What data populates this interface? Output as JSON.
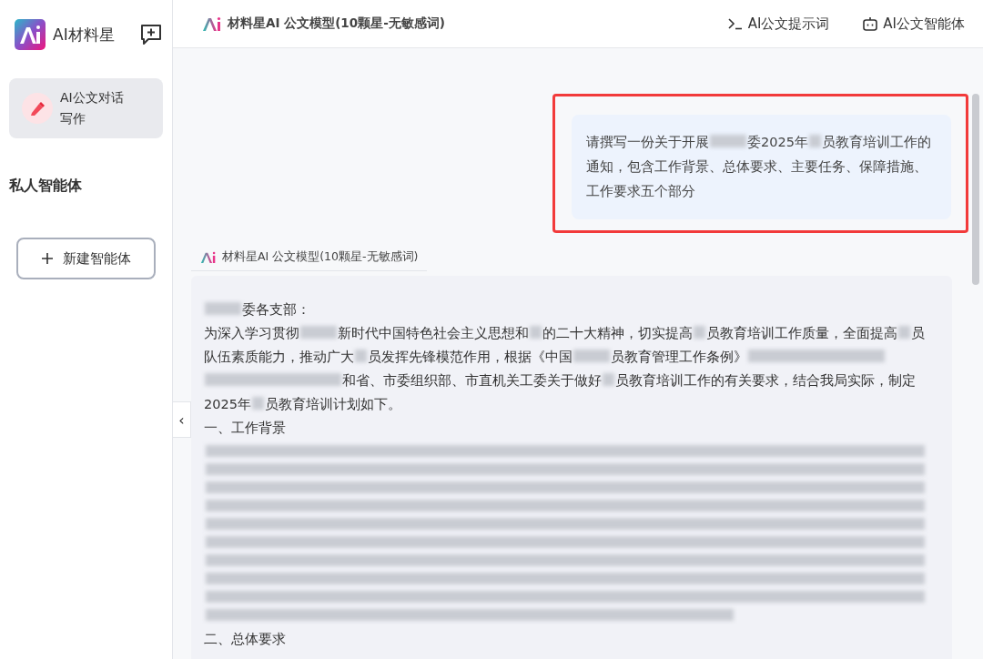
{
  "sidebar": {
    "app_name": "AI材料星",
    "nav_items": [
      {
        "label": "AI公文对话写作",
        "selected": true
      }
    ],
    "section_title": "私人智能体",
    "new_agent_button": "新建智能体",
    "collapse_toggle": "‹"
  },
  "header": {
    "model_name": "材料星AI 公文模型(10颗星-无敏感词)",
    "links": [
      {
        "kind": "prompt",
        "label": "AI公文提示词"
      },
      {
        "kind": "agent",
        "label": "AI公文智能体"
      }
    ]
  },
  "chat": {
    "user_message": {
      "highlighted": true,
      "segments": [
        {
          "kind": "text",
          "text": "请撰写一份关于开展"
        },
        {
          "kind": "word"
        },
        {
          "kind": "text",
          "text": "委2025年"
        },
        {
          "kind": "dot"
        },
        {
          "kind": "text",
          "text": "员教育培训工作的通知，包含工作背景、总体要求、主要任务、保障措施、工作要求五个部分"
        }
      ]
    },
    "reply": {
      "model_name": "材料星AI 公文模型(10颗星-无敏感词)",
      "paragraphs": [
        {
          "segments": [
            {
              "kind": "word"
            },
            {
              "kind": "text",
              "text": "委各支部："
            }
          ]
        },
        {
          "segments": [
            {
              "kind": "text",
              "text": "为深入学习贯彻"
            },
            {
              "kind": "word"
            },
            {
              "kind": "text",
              "text": "新时代中国特色社会主义思想和"
            },
            {
              "kind": "dot"
            },
            {
              "kind": "text",
              "text": "的二十大精神，切实提高"
            },
            {
              "kind": "dot"
            },
            {
              "kind": "text",
              "text": "员教育培训工作质量，全面提高"
            },
            {
              "kind": "dot"
            },
            {
              "kind": "text",
              "text": "员队伍素质能力，推动广大"
            },
            {
              "kind": "dot"
            },
            {
              "kind": "text",
              "text": "员发挥先锋模范作用，根据《中国"
            },
            {
              "kind": "word"
            },
            {
              "kind": "text",
              "text": "员教育管理工作条例》"
            },
            {
              "kind": "phrase"
            },
            {
              "kind": "phrase"
            },
            {
              "kind": "text",
              "text": "和省、市委组织部、市直机关工委关于做好"
            },
            {
              "kind": "dot"
            },
            {
              "kind": "text",
              "text": "员教育培训工作的有关要求，结合我局实际，制定2025年"
            },
            {
              "kind": "dot"
            },
            {
              "kind": "text",
              "text": "员教育培训计划如下。"
            }
          ]
        },
        {
          "segments": [
            {
              "kind": "text",
              "text": "一、工作背景"
            }
          ]
        },
        {
          "segments": [
            {
              "kind": "line"
            },
            {
              "kind": "line"
            },
            {
              "kind": "line"
            },
            {
              "kind": "line"
            },
            {
              "kind": "line"
            },
            {
              "kind": "line"
            },
            {
              "kind": "line"
            },
            {
              "kind": "line"
            },
            {
              "kind": "line"
            },
            {
              "kind": "partline"
            }
          ]
        },
        {
          "segments": [
            {
              "kind": "text",
              "text": "二、总体要求"
            }
          ]
        }
      ]
    }
  }
}
